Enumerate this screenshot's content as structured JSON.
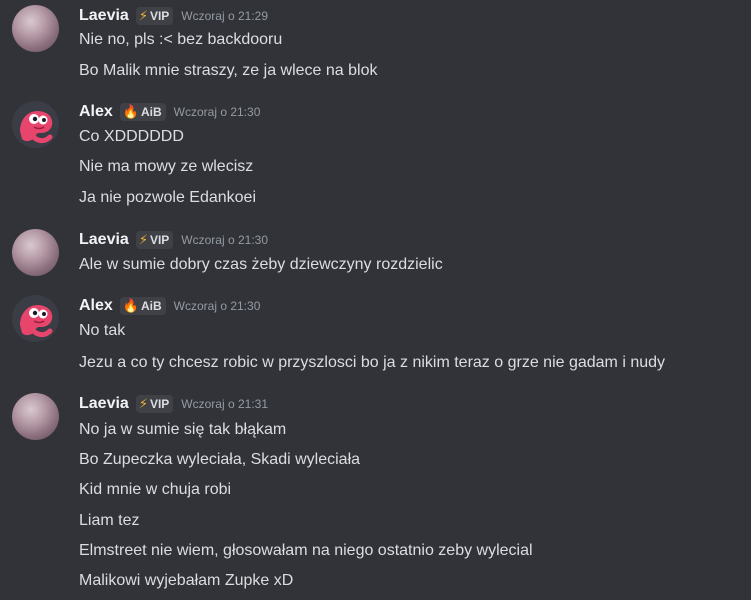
{
  "messages": [
    {
      "author": "Laevia",
      "tag_icon": "lightning-icon",
      "tag_text": "VIP",
      "time": "Wczoraj o 21:29",
      "lines": [
        "Nie no, pls :< bez backdooru",
        "Bo Malik mnie straszy, ze ja wlece na blok"
      ]
    },
    {
      "author": "Alex",
      "tag_icon": "fire-icon",
      "tag_text": "AiB",
      "time": "Wczoraj o 21:30",
      "lines": [
        "Co XDDDDDD",
        "Nie ma mowy ze wlecisz",
        "Ja nie pozwole Edankoei"
      ]
    },
    {
      "author": "Laevia",
      "tag_icon": "lightning-icon",
      "tag_text": "VIP",
      "time": "Wczoraj o 21:30",
      "lines": [
        "Ale w sumie dobry czas żeby dziewczyny rozdzielic"
      ]
    },
    {
      "author": "Alex",
      "tag_icon": "fire-icon",
      "tag_text": "AiB",
      "time": "Wczoraj o 21:30",
      "lines": [
        "No tak",
        "Jezu a co ty chcesz robic w przyszlosci bo ja z nikim teraz o grze nie gadam i nudy"
      ]
    },
    {
      "author": "Laevia",
      "tag_icon": "lightning-icon",
      "tag_text": "VIP",
      "time": "Wczoraj o 21:31",
      "lines": [
        "No ja w sumie się tak błąkam",
        "Bo Zupeczka wyleciała, Skadi wyleciała",
        "Kid mnie w chuja robi",
        "Liam tez",
        "Elmstreet nie wiem, głosowałam na niego ostatnio zeby wylecial",
        "Malikowi wyjebałam Zupke xD"
      ]
    }
  ]
}
